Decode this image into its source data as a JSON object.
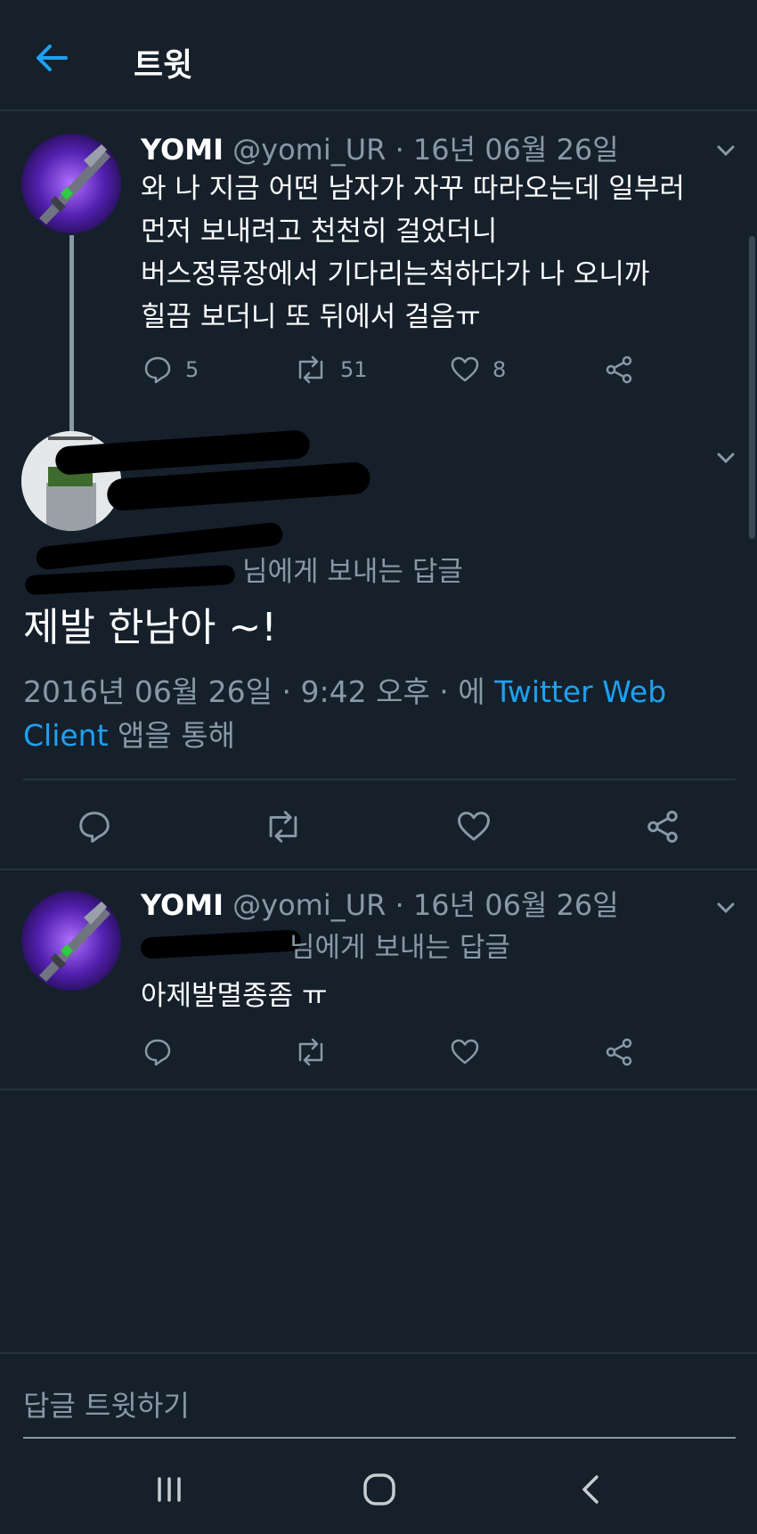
{
  "header": {
    "title": "트윗"
  },
  "tweet1": {
    "name": "YOMI",
    "handle_date": "@yomi_UR · 16년 06월 26일",
    "text": "와 나 지금 어떤 남자가 자꾸 따라오는데 일부러\n먼저 보내려고 천천히 걸었더니\n버스정류장에서 기다리는척하다가 나 오니까\n힐끔 보더니 또 뒤에서 걸음ㅠ",
    "replies": "5",
    "retweets": "51",
    "likes": "8"
  },
  "main_tweet": {
    "reply_to": "님에게 보내는 답글",
    "text": "제발 한남아 ~!",
    "timestamp": "2016년 06월 26일 · 9:42 오후 · 에 ",
    "client": "Twitter Web",
    "client2": "Client",
    "via": " 앱을 통해"
  },
  "tweet3": {
    "name": "YOMI",
    "handle_date": "@yomi_UR · 16년 06월 26일",
    "reply_to": "님에게 보내는 답글",
    "text": "아제발멸종좀 ㅠ"
  },
  "compose": {
    "placeholder": "답글 트윗하기"
  },
  "icons": {
    "back": "arrow-left-icon",
    "reply": "comment-icon",
    "retweet": "retweet-icon",
    "like": "heart-icon",
    "share": "share-icon",
    "more": "chevron-down-icon"
  },
  "colors": {
    "background": "#15202b",
    "accent": "#1da1f2",
    "secondary_text": "#8899a6",
    "divider": "#253341"
  }
}
